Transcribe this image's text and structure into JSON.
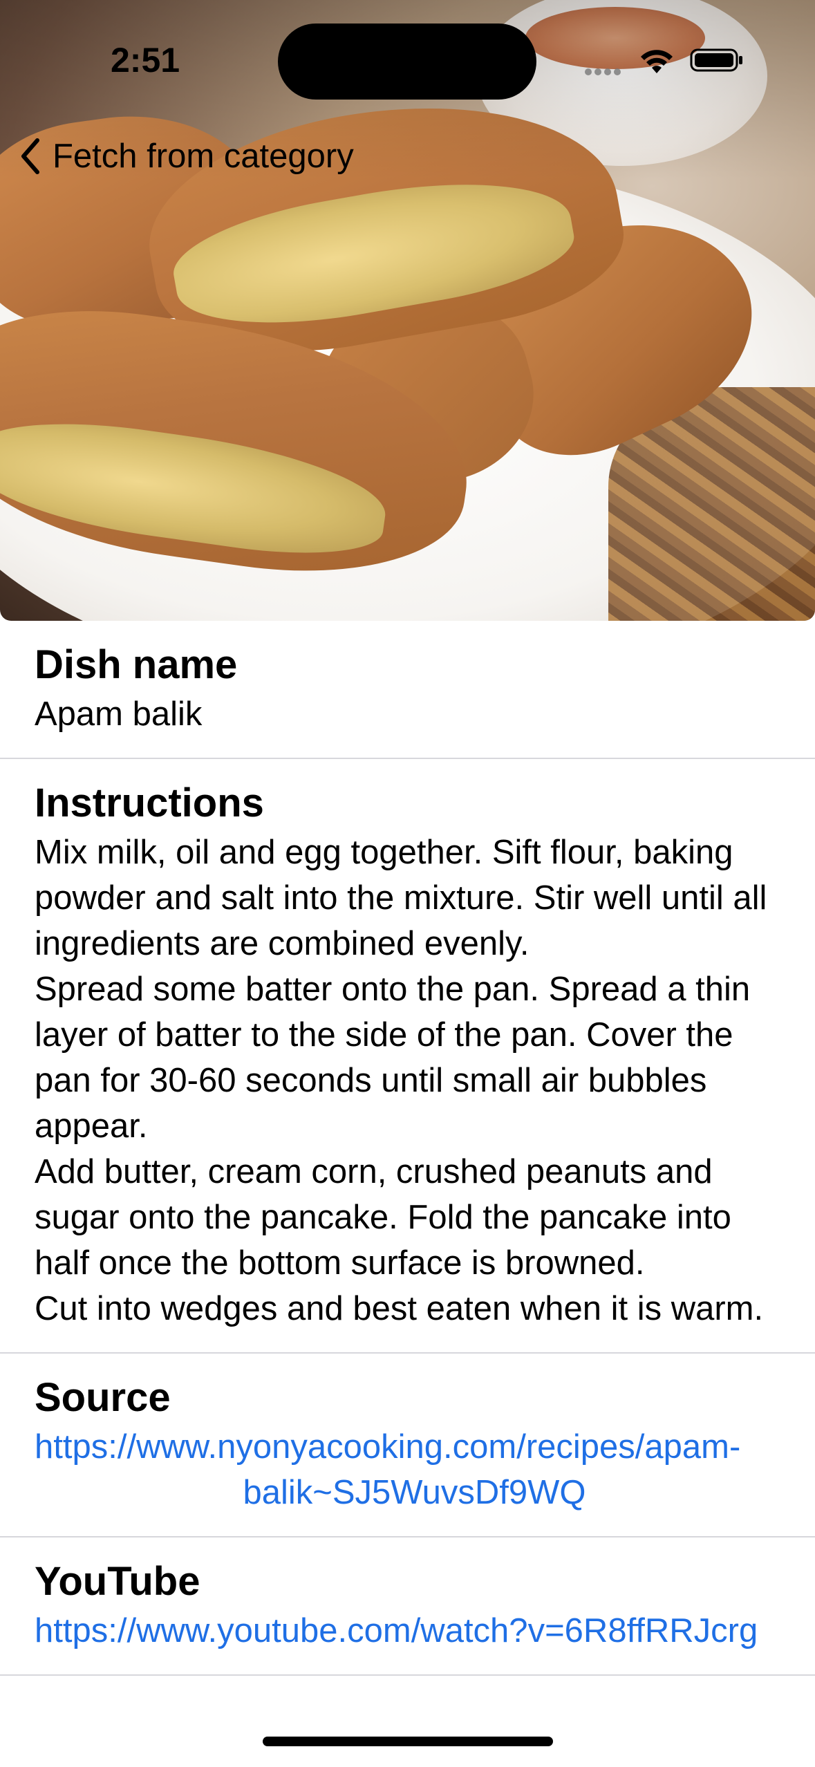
{
  "status_bar": {
    "time": "2:51"
  },
  "navigation": {
    "back_label": "Fetch from category"
  },
  "hero": {
    "image_description_icon": "food-photo"
  },
  "sections": {
    "dish_name": {
      "title": "Dish name",
      "value": "Apam balik"
    },
    "instructions": {
      "title": "Instructions",
      "value": "Mix milk, oil and egg together. Sift flour, baking powder and salt into the mixture. Stir well until all ingredients are combined evenly.\nSpread some batter onto the pan. Spread a thin layer of batter to the side of the pan. Cover the pan for 30-60 seconds until small air bubbles appear.\nAdd butter, cream corn, crushed peanuts and sugar onto the pancake. Fold the pancake into half once the bottom surface is browned.\nCut into wedges and best eaten when it is warm."
    },
    "source": {
      "title": "Source",
      "link_line1": "https://www.nyonyacooking.com/recipes/apam-",
      "link_line2": "balik~SJ5WuvsDf9WQ"
    },
    "youtube": {
      "title": "YouTube",
      "link": "https://www.youtube.com/watch?v=6R8ffRRJcrg"
    }
  },
  "colors": {
    "link": "#1f6fe5",
    "separator": "#d7d7dc"
  }
}
